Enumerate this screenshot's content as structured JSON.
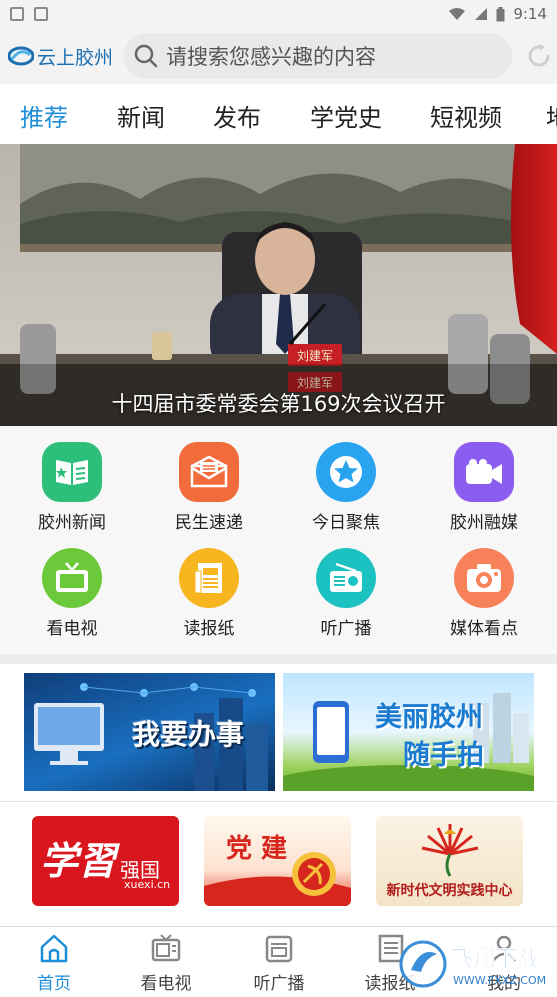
{
  "status_bar": {
    "time": "9:14"
  },
  "header": {
    "app_name": "云上胶州",
    "search_placeholder": "请搜索您感兴趣的内容"
  },
  "tabs": [
    {
      "label": "推荐",
      "active": true
    },
    {
      "label": "新闻",
      "active": false
    },
    {
      "label": "发布",
      "active": false
    },
    {
      "label": "学党史",
      "active": false
    },
    {
      "label": "短视频",
      "active": false
    }
  ],
  "banner": {
    "caption": "十四届市委常委会第169次会议召开",
    "nameplates": [
      "刘建军",
      "刘建军"
    ]
  },
  "grid": [
    {
      "label": "胶州新闻",
      "icon": "news-book-icon",
      "color": "#2bbf7a"
    },
    {
      "label": "民生速递",
      "icon": "mail-envelope-icon",
      "color": "#f26b3a"
    },
    {
      "label": "今日聚焦",
      "icon": "star-icon",
      "color": "#2aa4ef"
    },
    {
      "label": "胶州融媒",
      "icon": "video-camera-icon",
      "color": "#8a5cf0"
    },
    {
      "label": "看电视",
      "icon": "tv-icon",
      "color": "#6cc93a"
    },
    {
      "label": "读报纸",
      "icon": "newspaper-icon",
      "color": "#f7b620"
    },
    {
      "label": "听广播",
      "icon": "radio-icon",
      "color": "#1cc2c2"
    },
    {
      "label": "媒体看点",
      "icon": "camera-icon",
      "color": "#f7825a"
    }
  ],
  "services": [
    {
      "label": "我要办事"
    },
    {
      "label_line1": "美丽胶州",
      "label_line2": "随手拍"
    }
  ],
  "links": [
    {
      "label_main": "学習",
      "label_sub": "强国",
      "label_url": "xuexi.cn"
    },
    {
      "label": "党 建"
    },
    {
      "label": "新时代文明实践中心"
    }
  ],
  "bottom_nav": [
    {
      "label": "首页",
      "icon": "home-icon",
      "active": true
    },
    {
      "label": "看电视",
      "icon": "tv-icon",
      "active": false
    },
    {
      "label": "听广播",
      "icon": "radio-icon",
      "active": false
    },
    {
      "label": "读报纸",
      "icon": "newspaper-icon",
      "active": false
    },
    {
      "label": "我的",
      "icon": "user-icon",
      "active": false
    }
  ],
  "watermark": {
    "text": "飞翔下载",
    "url": "WWW.FXXZ.COM"
  }
}
